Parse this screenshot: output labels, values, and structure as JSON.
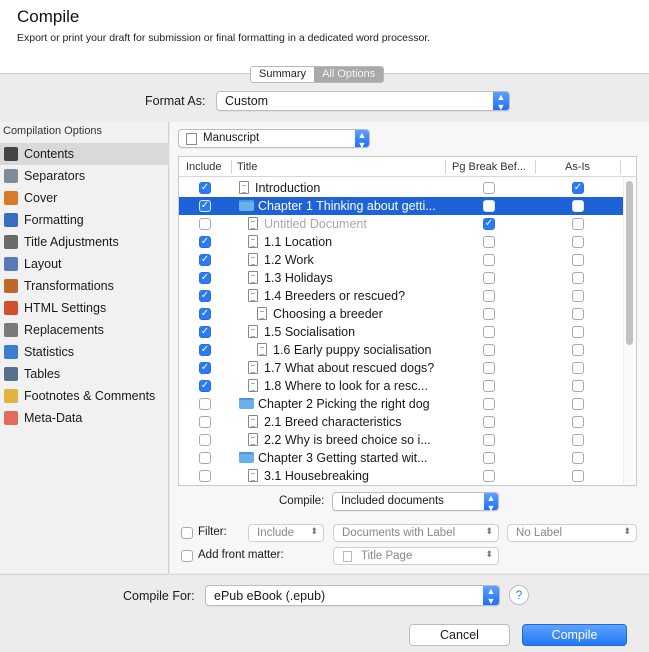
{
  "header": {
    "title": "Compile",
    "subtitle": "Export or print your draft for submission or final formatting in a dedicated word processor."
  },
  "tabs": [
    {
      "label": "Summary",
      "active": true
    },
    {
      "label": "All Options",
      "active": false
    }
  ],
  "format": {
    "label": "Format As:",
    "value": "Custom"
  },
  "sidebar": {
    "title": "Compilation Options",
    "items": [
      {
        "label": "Contents",
        "icon": "contents-icon",
        "selected": true
      },
      {
        "label": "Separators",
        "icon": "separators-icon"
      },
      {
        "label": "Cover",
        "icon": "cover-icon"
      },
      {
        "label": "Formatting",
        "icon": "formatting-icon"
      },
      {
        "label": "Title Adjustments",
        "icon": "title-adjustments-icon"
      },
      {
        "label": "Layout",
        "icon": "layout-icon"
      },
      {
        "label": "Transformations",
        "icon": "transformations-icon"
      },
      {
        "label": "HTML Settings",
        "icon": "html-settings-icon"
      },
      {
        "label": "Replacements",
        "icon": "replacements-icon"
      },
      {
        "label": "Statistics",
        "icon": "statistics-icon"
      },
      {
        "label": "Tables",
        "icon": "tables-icon"
      },
      {
        "label": "Footnotes & Comments",
        "icon": "footnotes-icon"
      },
      {
        "label": "Meta-Data",
        "icon": "meta-data-icon"
      }
    ]
  },
  "content": {
    "manuscript_select": "Manuscript",
    "columns": [
      "Include",
      "Title",
      "Pg Break Bef...",
      "As-Is"
    ],
    "rows": [
      {
        "title": "Introduction",
        "type": "doc",
        "level": 0,
        "include": true,
        "pgbreak": false,
        "asis": true
      },
      {
        "title": "Chapter 1  Thinking about getti...",
        "type": "folder",
        "level": 0,
        "include": true,
        "pgbreak": false,
        "asis": false,
        "selected": true
      },
      {
        "title": "Untitled Document",
        "type": "doc",
        "level": 1,
        "include": false,
        "pgbreak": true,
        "asis": false,
        "dim": true
      },
      {
        "title": "1.1  Location",
        "type": "doc",
        "level": 1,
        "include": true,
        "pgbreak": false,
        "asis": false
      },
      {
        "title": "1.2  Work",
        "type": "doc",
        "level": 1,
        "include": true,
        "pgbreak": false,
        "asis": false
      },
      {
        "title": "1.3  Holidays",
        "type": "doc",
        "level": 1,
        "include": true,
        "pgbreak": false,
        "asis": false
      },
      {
        "title": "1.4  Breeders or rescued?",
        "type": "doc",
        "level": 1,
        "include": true,
        "pgbreak": false,
        "asis": false
      },
      {
        "title": "Choosing a breeder",
        "type": "doc",
        "level": 2,
        "include": true,
        "pgbreak": false,
        "asis": false
      },
      {
        "title": "1.5  Socialisation",
        "type": "doc",
        "level": 1,
        "include": true,
        "pgbreak": false,
        "asis": false
      },
      {
        "title": "1.6  Early puppy socialisation",
        "type": "doc",
        "level": 2,
        "include": true,
        "pgbreak": false,
        "asis": false
      },
      {
        "title": "1.7  What about rescued dogs?",
        "type": "doc",
        "level": 1,
        "include": true,
        "pgbreak": false,
        "asis": false
      },
      {
        "title": "1.8  Where to look for a resc...",
        "type": "doc",
        "level": 1,
        "include": true,
        "pgbreak": false,
        "asis": false
      },
      {
        "title": "Chapter 2  Picking the right dog",
        "type": "folder",
        "level": 0,
        "include": false,
        "pgbreak": false,
        "asis": false
      },
      {
        "title": "2.1  Breed characteristics",
        "type": "doc",
        "level": 1,
        "include": false,
        "pgbreak": false,
        "asis": false
      },
      {
        "title": "2.2  Why is breed choice so i...",
        "type": "doc",
        "level": 1,
        "include": false,
        "pgbreak": false,
        "asis": false
      },
      {
        "title": "Chapter 3  Getting started wit...",
        "type": "folder",
        "level": 0,
        "include": false,
        "pgbreak": false,
        "asis": false
      },
      {
        "title": "3.1  Housebreaking",
        "type": "doc",
        "level": 1,
        "include": false,
        "pgbreak": false,
        "asis": false
      }
    ],
    "compile_label": "Compile:",
    "compile_value": "Included documents",
    "filter": {
      "label": "Filter:",
      "include": "Include",
      "docs_with": "Documents with Label",
      "label_value": "No Label"
    },
    "front_matter": {
      "label": "Add front matter:",
      "value": "Title Page"
    }
  },
  "footer": {
    "compile_for_label": "Compile For:",
    "compile_for_value": "ePub eBook (.epub)",
    "help": "?",
    "cancel": "Cancel",
    "compile": "Compile"
  },
  "colors": {
    "accent": "#2a7cf6",
    "selection": "#1d63d7"
  }
}
